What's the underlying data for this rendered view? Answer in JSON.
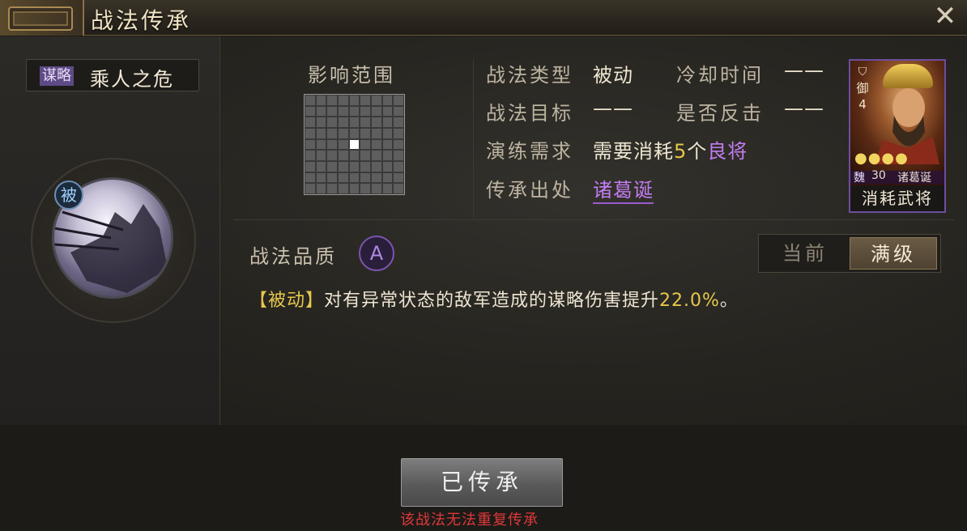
{
  "window": {
    "title": "战法传承",
    "close_icon": "close-icon"
  },
  "skill": {
    "category": "谋略",
    "name": "乘人之危",
    "type_badge": "被"
  },
  "range": {
    "title": "影响范围"
  },
  "info": {
    "type_label": "战法类型",
    "type_value": "被动",
    "cooldown_label": "冷却时间",
    "cooldown_value": "——",
    "target_label": "战法目标",
    "target_value": "——",
    "counter_label": "是否反击",
    "counter_value": "——",
    "train_label": "演练需求",
    "train_prefix": "需要消耗",
    "train_count": "5",
    "train_unit": "个",
    "train_suffix": "良将",
    "source_label": "传承出处",
    "source_value": "诸葛诞"
  },
  "card": {
    "class": "御",
    "class_level": "4",
    "faction": "魏",
    "level": "30",
    "name": "诸葛诞",
    "footer": "消耗武将"
  },
  "quality": {
    "label": "战法品质",
    "grade": "A"
  },
  "level_toggle": {
    "current": "当前",
    "max": "满级"
  },
  "description": {
    "tag": "【被动】",
    "text": "对有异常状态的敌军造成的谋略伤害提升",
    "value": "22.0%",
    "end": "。"
  },
  "actions": {
    "inherit_button": "已传承",
    "warning": "该战法无法重复传承"
  },
  "colors": {
    "accent_yellow": "#e6c84a",
    "accent_purple": "#c27cf0",
    "warning_red": "#e0383a"
  }
}
